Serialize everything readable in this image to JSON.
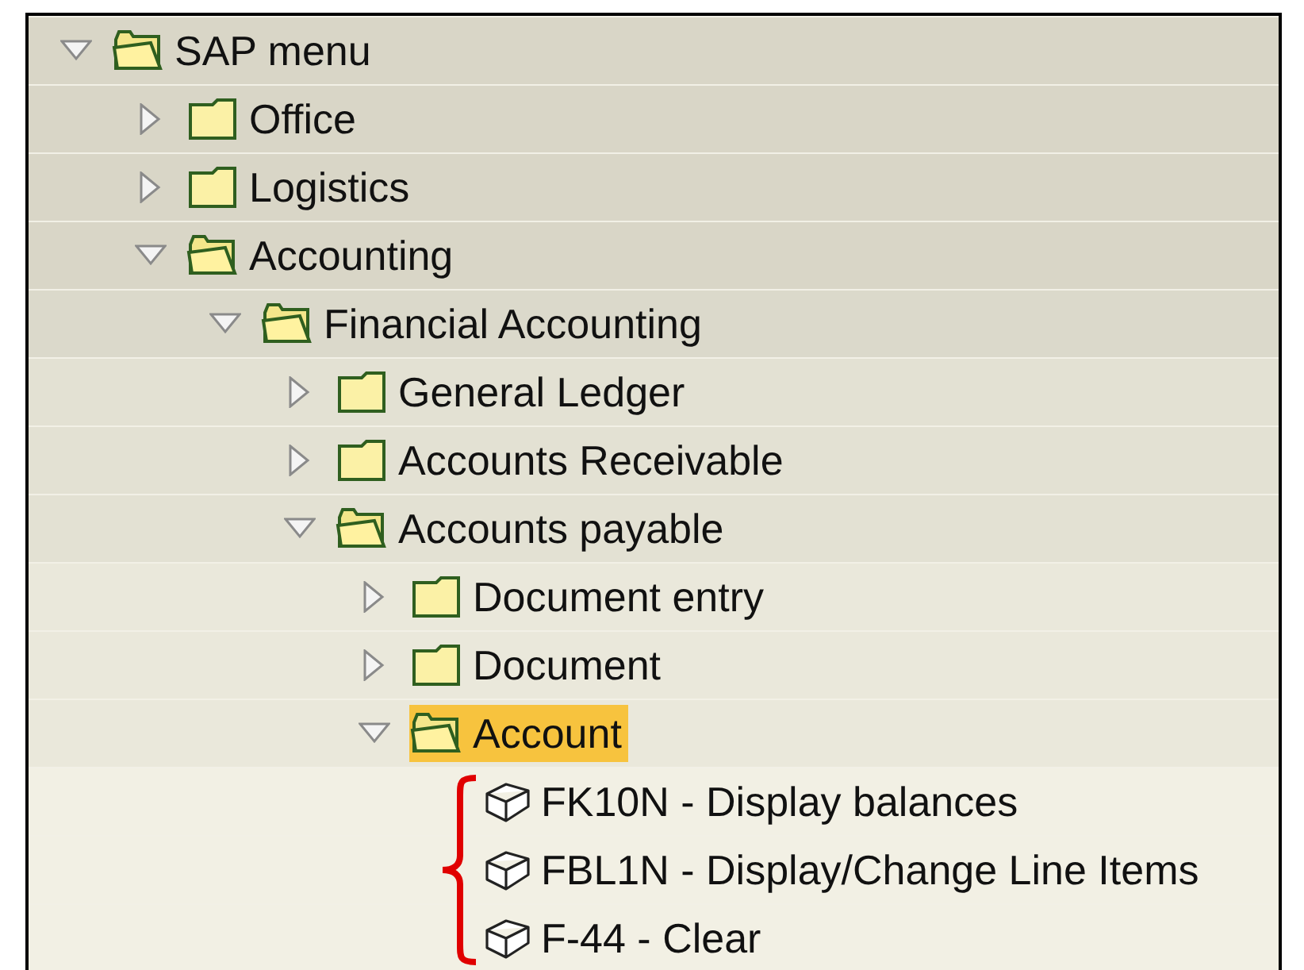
{
  "tree": [
    {
      "kind": "folder",
      "label": "SAP menu",
      "expanded": true,
      "selected": false,
      "children": [
        {
          "kind": "folder",
          "label": "Office",
          "expanded": false,
          "selected": false
        },
        {
          "kind": "folder",
          "label": "Logistics",
          "expanded": false,
          "selected": false
        },
        {
          "kind": "folder",
          "label": "Accounting",
          "expanded": true,
          "selected": false,
          "children": [
            {
              "kind": "folder",
              "label": "Financial Accounting",
              "expanded": true,
              "selected": false,
              "children": [
                {
                  "kind": "folder",
                  "label": "General Ledger",
                  "expanded": false,
                  "selected": false
                },
                {
                  "kind": "folder",
                  "label": "Accounts Receivable",
                  "expanded": false,
                  "selected": false
                },
                {
                  "kind": "folder",
                  "label": "Accounts payable",
                  "expanded": true,
                  "selected": false,
                  "children": [
                    {
                      "kind": "folder",
                      "label": "Document entry",
                      "expanded": false,
                      "selected": false
                    },
                    {
                      "kind": "folder",
                      "label": "Document",
                      "expanded": false,
                      "selected": false
                    },
                    {
                      "kind": "folder",
                      "label": "Account",
                      "expanded": true,
                      "selected": true,
                      "bracketed": true,
                      "children": [
                        {
                          "kind": "transaction",
                          "label": "FK10N - Display balances",
                          "selected": false
                        },
                        {
                          "kind": "transaction",
                          "label": "FBL1N - Display/Change Line Items",
                          "selected": false
                        },
                        {
                          "kind": "transaction",
                          "label": "F-44 - Clear",
                          "selected": false
                        }
                      ]
                    }
                  ]
                }
              ]
            }
          ]
        }
      ]
    }
  ]
}
